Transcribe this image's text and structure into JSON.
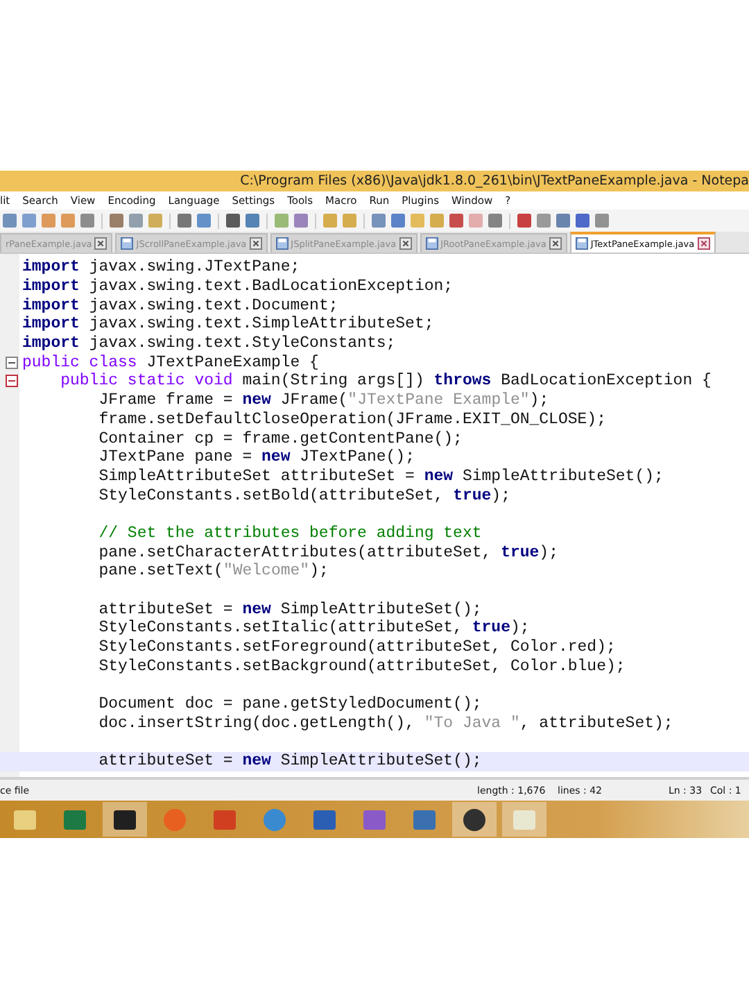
{
  "window": {
    "title": "C:\\Program Files (x86)\\Java\\jdk1.8.0_261\\bin\\JTextPaneExample.java - Notepa"
  },
  "menu": [
    "lit",
    "Search",
    "View",
    "Encoding",
    "Language",
    "Settings",
    "Tools",
    "Macro",
    "Run",
    "Plugins",
    "Window",
    "?"
  ],
  "tabs": [
    {
      "label": "rPaneExample.java",
      "selected": false
    },
    {
      "label": "JScrollPaneExample.java",
      "selected": false
    },
    {
      "label": "JSplitPaneExample.java",
      "selected": false
    },
    {
      "label": "JRootPaneExample.java",
      "selected": false
    },
    {
      "label": "JTextPaneExample.java",
      "selected": true
    }
  ],
  "editor": {
    "lines": [
      {
        "current": false,
        "tokens": [
          {
            "kind": "keyword",
            "t": "import"
          },
          {
            "kind": "text",
            "t": " javax.swing.JTextPane;"
          }
        ]
      },
      {
        "current": false,
        "tokens": [
          {
            "kind": "keyword",
            "t": "import"
          },
          {
            "kind": "text",
            "t": " javax.swing.text.BadLocationException;"
          }
        ]
      },
      {
        "current": false,
        "tokens": [
          {
            "kind": "keyword",
            "t": "import"
          },
          {
            "kind": "text",
            "t": " javax.swing.text.Document;"
          }
        ]
      },
      {
        "current": false,
        "tokens": [
          {
            "kind": "keyword",
            "t": "import"
          },
          {
            "kind": "text",
            "t": " javax.swing.text.SimpleAttributeSet;"
          }
        ]
      },
      {
        "current": false,
        "tokens": [
          {
            "kind": "keyword",
            "t": "import"
          },
          {
            "kind": "text",
            "t": " javax.swing.text.StyleConstants;"
          }
        ]
      },
      {
        "current": false,
        "kind": "fold",
        "tokens": [
          {
            "kind": "modifier",
            "t": "public class"
          },
          {
            "kind": "text",
            "t": " JTextPaneExample {"
          }
        ]
      },
      {
        "current": false,
        "kind": "fold-active",
        "tokens": [
          {
            "kind": "modifier",
            "t": "    public static void"
          },
          {
            "kind": "text",
            "t": " main(String args[]) "
          },
          {
            "kind": "keyword",
            "t": "throws"
          },
          {
            "kind": "text",
            "t": " BadLocationException {"
          }
        ]
      },
      {
        "current": false,
        "tokens": [
          {
            "kind": "text",
            "t": "        JFrame frame = "
          },
          {
            "kind": "keyword",
            "t": "new"
          },
          {
            "kind": "text",
            "t": " JFrame("
          },
          {
            "kind": "string",
            "t": "\"JTextPane Example\""
          },
          {
            "kind": "text",
            "t": ");"
          }
        ]
      },
      {
        "current": false,
        "tokens": [
          {
            "kind": "text",
            "t": "        frame.setDefaultCloseOperation(JFrame.EXIT_ON_CLOSE);"
          }
        ]
      },
      {
        "current": false,
        "tokens": [
          {
            "kind": "text",
            "t": "        Container cp = frame.getContentPane();"
          }
        ]
      },
      {
        "current": false,
        "tokens": [
          {
            "kind": "text",
            "t": "        JTextPane pane = "
          },
          {
            "kind": "keyword",
            "t": "new"
          },
          {
            "kind": "text",
            "t": " JTextPane();"
          }
        ]
      },
      {
        "current": false,
        "tokens": [
          {
            "kind": "text",
            "t": "        SimpleAttributeSet attributeSet = "
          },
          {
            "kind": "keyword",
            "t": "new"
          },
          {
            "kind": "text",
            "t": " SimpleAttributeSet();"
          }
        ]
      },
      {
        "current": false,
        "tokens": [
          {
            "kind": "text",
            "t": "        StyleConstants.setBold(attributeSet, "
          },
          {
            "kind": "keyword",
            "t": "true"
          },
          {
            "kind": "text",
            "t": ");"
          }
        ]
      },
      {
        "current": false
      },
      {
        "current": false,
        "tokens": [
          {
            "kind": "comment",
            "t": "        // Set the attributes before adding text"
          }
        ]
      },
      {
        "current": false,
        "tokens": [
          {
            "kind": "text",
            "t": "        pane.setCharacterAttributes(attributeSet, "
          },
          {
            "kind": "keyword",
            "t": "true"
          },
          {
            "kind": "text",
            "t": ");"
          }
        ]
      },
      {
        "current": false,
        "tokens": [
          {
            "kind": "text",
            "t": "        pane.setText("
          },
          {
            "kind": "string",
            "t": "\"Welcome\""
          },
          {
            "kind": "text",
            "t": ");"
          }
        ]
      },
      {
        "current": false
      },
      {
        "current": false,
        "tokens": [
          {
            "kind": "text",
            "t": "        attributeSet = "
          },
          {
            "kind": "keyword",
            "t": "new"
          },
          {
            "kind": "text",
            "t": " SimpleAttributeSet();"
          }
        ]
      },
      {
        "current": false,
        "tokens": [
          {
            "kind": "text",
            "t": "        StyleConstants.setItalic(attributeSet, "
          },
          {
            "kind": "keyword",
            "t": "true"
          },
          {
            "kind": "text",
            "t": ");"
          }
        ]
      },
      {
        "current": false,
        "tokens": [
          {
            "kind": "text",
            "t": "        StyleConstants.setForeground(attributeSet, Color.red);"
          }
        ]
      },
      {
        "current": false,
        "tokens": [
          {
            "kind": "text",
            "t": "        StyleConstants.setBackground(attributeSet, Color.blue);"
          }
        ]
      },
      {
        "current": false
      },
      {
        "current": false,
        "tokens": [
          {
            "kind": "text",
            "t": "        Document doc = pane.getStyledDocument();"
          }
        ]
      },
      {
        "current": false,
        "tokens": [
          {
            "kind": "text",
            "t": "        doc.insertString(doc.getLength(), "
          },
          {
            "kind": "string",
            "t": "\"To Java \""
          },
          {
            "kind": "text",
            "t": ", attributeSet);"
          }
        ]
      },
      {
        "current": false
      },
      {
        "current": true,
        "tokens": [
          {
            "kind": "text",
            "t": "        attributeSet = "
          },
          {
            "kind": "keyword",
            "t": "new"
          },
          {
            "kind": "text",
            "t": " SimpleAttributeSet();"
          }
        ]
      }
    ]
  },
  "status_bar": {
    "file_type": "ce file",
    "length": "length : 1,676",
    "lines": "lines : 42",
    "position": "Ln : 33",
    "column": "Col : 1"
  },
  "taskbar": [
    {
      "running": false
    },
    {
      "running": false
    },
    {
      "running": true
    },
    {
      "running": false
    },
    {
      "running": false
    },
    {
      "running": false
    },
    {
      "running": false
    },
    {
      "running": false
    },
    {
      "running": false
    },
    {
      "running": true
    },
    {
      "running": true
    }
  ]
}
